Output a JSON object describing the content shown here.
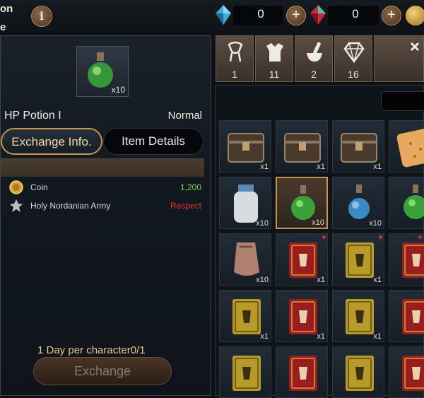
{
  "topbar": {
    "title_line1": "on",
    "title_line2": "e",
    "info_label": "i",
    "currency_blue": {
      "icon": "blue-crystal-icon",
      "value": "0",
      "plus": "+"
    },
    "currency_red": {
      "icon": "red-crystal-icon",
      "value": "0",
      "plus": "+"
    },
    "coin_icon": "gold-coin-icon"
  },
  "item": {
    "icon": "green-potion-icon",
    "count": "x10",
    "name": "HP Potion I",
    "grade": "Normal"
  },
  "tabs": {
    "exchange_info": "Exchange Info.",
    "item_details": "Item Details"
  },
  "costs": [
    {
      "icon": "gold-coin-icon",
      "name": "Coin",
      "value": "1,200",
      "color": "#7fd24a"
    },
    {
      "icon": "army-emblem-icon",
      "name": "Holy Nordanian Army",
      "value": "Respect",
      "color": "#e0342c"
    }
  ],
  "limit_text": "1 Day per character0/1",
  "exchange_button": "Exchange",
  "categories": [
    {
      "icon": "bundle-icon",
      "count": "1"
    },
    {
      "icon": "armor-icon",
      "count": "11"
    },
    {
      "icon": "pestle-icon",
      "count": "2"
    },
    {
      "icon": "diamond-icon",
      "count": "16"
    },
    {
      "icon": "misc-icon",
      "count": ""
    }
  ],
  "inventory": [
    {
      "icon": "chest-icon",
      "qty": "x1"
    },
    {
      "icon": "chest-icon",
      "qty": "x1"
    },
    {
      "icon": "chest-icon",
      "qty": "x1"
    },
    {
      "icon": "cracker-icon",
      "qty": ""
    },
    {
      "icon": "white-jar-icon",
      "qty": "x10"
    },
    {
      "icon": "green-potion-icon",
      "qty": "x10"
    },
    {
      "icon": "blue-potion-icon",
      "qty": "x10"
    },
    {
      "icon": "green-potion-icon",
      "qty": ""
    },
    {
      "icon": "cloth-icon",
      "qty": "x10"
    },
    {
      "icon": "red-book-icon",
      "qty": "x1"
    },
    {
      "icon": "yellow-book-icon",
      "qty": "x1"
    },
    {
      "icon": "red-book-icon",
      "qty": ""
    },
    {
      "icon": "yellow-book-icon",
      "qty": "x1"
    },
    {
      "icon": "red-book-icon",
      "qty": "x1"
    },
    {
      "icon": "yellow-book-icon",
      "qty": "x1"
    },
    {
      "icon": "red-book-icon",
      "qty": ""
    },
    {
      "icon": "yellow-book-icon",
      "qty": ""
    },
    {
      "icon": "red-book-icon",
      "qty": ""
    },
    {
      "icon": "yellow-book-icon",
      "qty": ""
    },
    {
      "icon": "red-book-icon",
      "qty": ""
    }
  ]
}
